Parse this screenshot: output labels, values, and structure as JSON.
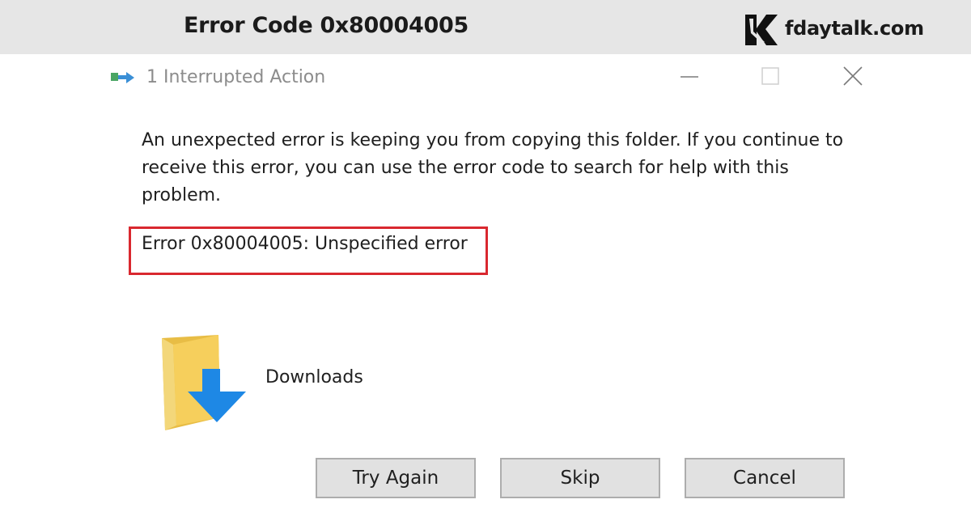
{
  "banner": {
    "title": "Error Code 0x80004005",
    "brand": "fdaytalk.com",
    "brand_logo_icon": "fdaytalk-logo-icon"
  },
  "dialog": {
    "title": "1 Interrupted Action",
    "title_icon": "file-transfer-icon",
    "window_controls": [
      "minimize-icon",
      "maximize-icon",
      "close-icon"
    ],
    "message": "An unexpected error is keeping you from copying this folder. If you continue to receive this error, you can use the error code to search for help with this problem.",
    "error_code": "Error 0x80004005: Unspecified error",
    "highlight_color": "#d9282f",
    "item": {
      "icon": "downloads-folder-icon",
      "name": "Downloads"
    },
    "buttons": {
      "try_again": "Try Again",
      "skip": "Skip",
      "cancel": "Cancel"
    }
  }
}
